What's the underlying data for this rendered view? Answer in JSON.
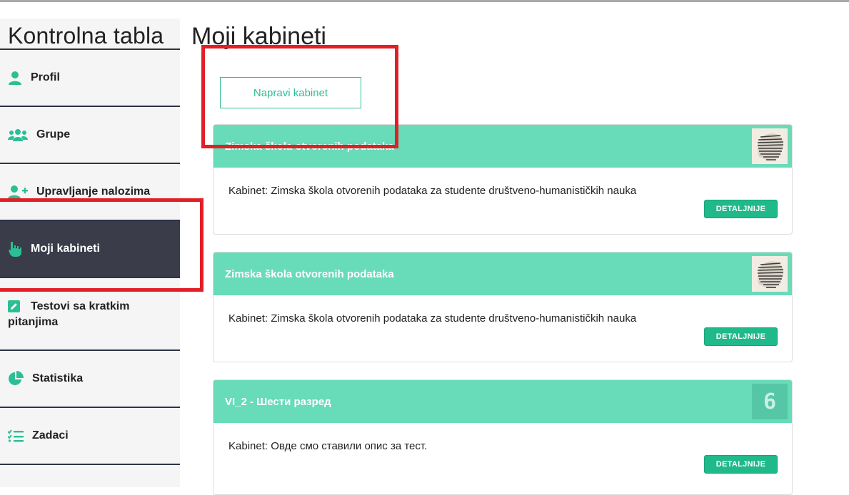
{
  "sidebar": {
    "title": "Kontrolna tabla",
    "items": [
      {
        "label": "Profil",
        "icon": "user-icon"
      },
      {
        "label": "Grupe",
        "icon": "users-icon"
      },
      {
        "label": "Upravljanje nalozima",
        "icon": "user-plus-icon"
      },
      {
        "label": "Moji kabineti",
        "icon": "hand-pointer-icon",
        "active": true
      },
      {
        "label": "Testovi sa kratkim pitanjima",
        "icon": "edit-icon"
      },
      {
        "label": "Statistika",
        "icon": "pie-chart-icon"
      },
      {
        "label": "Zadaci",
        "icon": "tasks-icon"
      }
    ]
  },
  "main": {
    "title": "Moji kabineti",
    "create_button": "Napravi kabinet",
    "cards": [
      {
        "title": "Zimska škola otvorenih podataka",
        "description": "Kabinet: Zimska škola otvorenih podataka za studente društveno-humanističkih nauka",
        "details_label": "DETALJNIJE"
      },
      {
        "title": "Zimska škola otvorenih podataka",
        "description": "Kabinet: Zimska škola otvorenih podataka za studente društveno-humanističkih nauka",
        "details_label": "DETALJNIJE"
      },
      {
        "title": "VI_2 - Шести разред",
        "description": "Kabinet: Овде смо ставили опис за тест.",
        "details_label": "DETALJNIJE",
        "thumb_text": "6"
      }
    ]
  },
  "colors": {
    "accent": "#1fb98a",
    "card_header": "#68dbb9",
    "active_nav": "#3b3c4a",
    "highlight": "#e21f26"
  }
}
